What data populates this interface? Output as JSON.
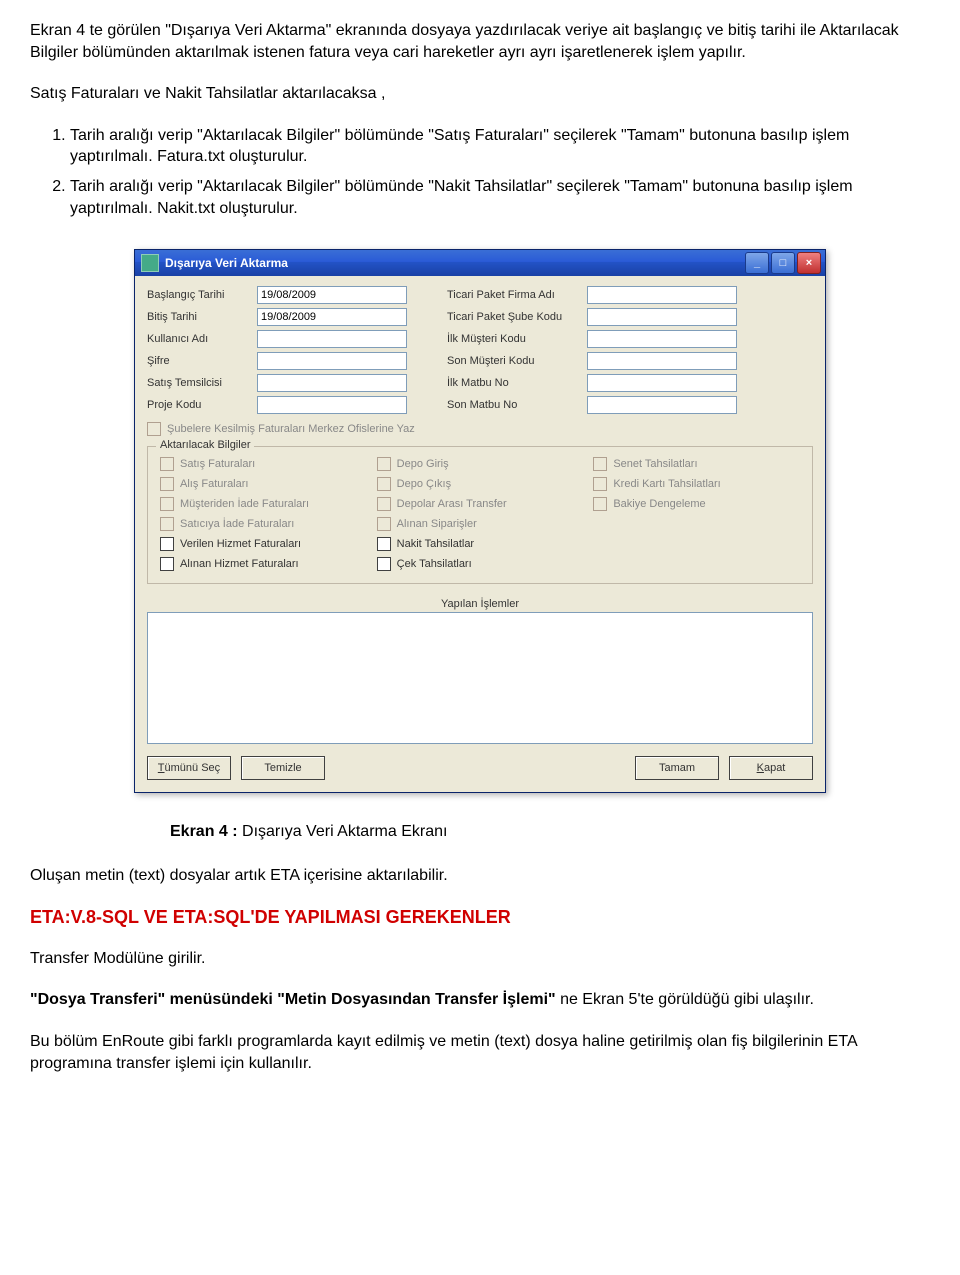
{
  "doc": {
    "intro": "Ekran 4 te görülen \"Dışarıya Veri Aktarma\" ekranında dosyaya yazdırılacak veriye ait başlangıç ve bitiş tarihi ile Aktarılacak Bilgiler bölümünden aktarılmak istenen fatura veya cari hareketler ayrı ayrı işaretlenerek işlem yapılır.",
    "line2": "Satış Faturaları ve Nakit Tahsilatlar aktarılacaksa ,",
    "step1": "Tarih aralığı verip \"Aktarılacak Bilgiler\" bölümünde \"Satış Faturaları\" seçilerek \"Tamam\" butonuna basılıp işlem yaptırılmalı. Fatura.txt oluşturulur.",
    "step2": "Tarih aralığı verip \"Aktarılacak Bilgiler\" bölümünde \"Nakit Tahsilatlar\" seçilerek \"Tamam\" butonuna basılıp işlem yaptırılmalı. Nakit.txt oluşturulur.",
    "caption_prefix": "Ekran 4 : ",
    "caption_rest": "Dışarıya Veri Aktarma Ekranı",
    "after1": "Oluşan metin (text) dosyalar artık ETA içerisine aktarılabilir.",
    "red_heading": "ETA:V.8-SQL VE ETA:SQL'DE YAPILMASI GEREKENLER",
    "after2": "Transfer Modülüne girilir.",
    "after3_a": "\"Dosya Transferi\" menüsündeki \"Metin Dosyasından Transfer İşlemi\" ",
    "after3_b": "ne Ekran 5'te görüldüğü gibi ulaşılır.",
    "after4": "Bu bölüm EnRoute gibi farklı programlarda kayıt edilmiş ve metin (text) dosya haline getirilmiş olan fiş bilgilerinin ETA programına transfer işlemi için kullanılır."
  },
  "win": {
    "title": "Dışarıya Veri Aktarma",
    "left_labels": {
      "l0": "Başlangıç Tarihi",
      "l1": "Bitiş Tarihi",
      "l2": "Kullanıcı Adı",
      "l3": "Şifre",
      "l4": "Satış Temsilcisi",
      "l5": "Proje Kodu"
    },
    "right_labels": {
      "r0": "Ticari Paket Firma Adı",
      "r1": "Ticari Paket Şube Kodu",
      "r2": "İlk Müşteri Kodu",
      "r3": "Son Müşteri Kodu",
      "r4": "İlk Matbu No",
      "r5": "Son Matbu No"
    },
    "values": {
      "start": "19/08/2009",
      "end": "19/08/2009"
    },
    "chk_merkez": "Şubelere Kesilmiş Faturaları Merkez Ofislerine Yaz",
    "group_title": "Aktarılacak Bilgiler",
    "g": {
      "c00": "Satış Faturaları",
      "c01": "Depo Giriş",
      "c02": "Senet Tahsilatları",
      "c10": "Alış Faturaları",
      "c11": "Depo Çıkış",
      "c12": "Kredi Kartı Tahsilatları",
      "c20": "Müşteriden İade Faturaları",
      "c21": "Depolar Arası Transfer",
      "c22": "Bakiye Dengeleme",
      "c30": "Satıcıya İade Faturaları",
      "c31": "Alınan Siparişler",
      "c40": "Verilen Hizmet Faturaları",
      "c41": "Nakit Tahsilatlar",
      "c50": "Alınan Hizmet Faturaları",
      "c51": "Çek Tahsilatları"
    },
    "list_title": "Yapılan İşlemler",
    "btn": {
      "all_u": "T",
      "all_r": "ümünü Seç",
      "clr": "Temizle",
      "ok": "Tamam",
      "close_u": "K",
      "close_r": "apat"
    }
  }
}
